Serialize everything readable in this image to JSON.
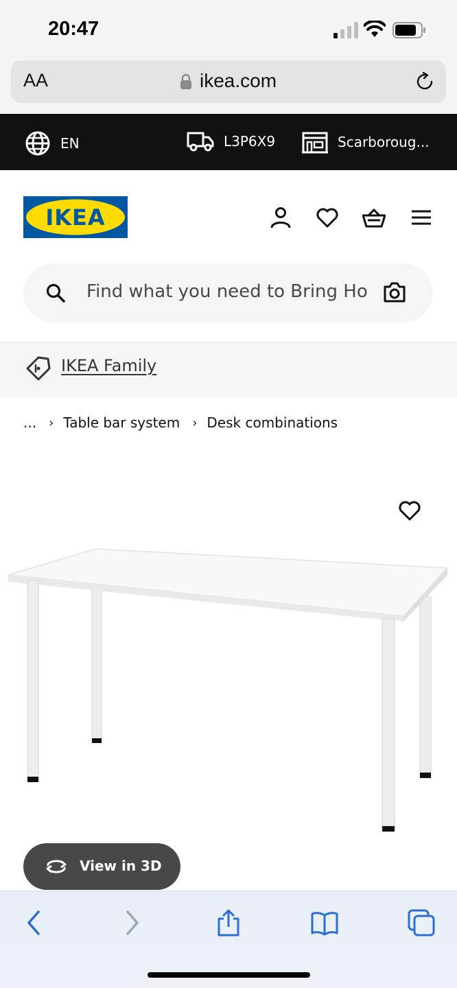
{
  "status_bar": {
    "time": "20:47",
    "icons": [
      "signal-icon",
      "wifi-icon",
      "battery-icon"
    ]
  },
  "browser": {
    "text_size_label": "AA",
    "url": "ikea.com",
    "icons": [
      "lock-icon",
      "reload-icon"
    ],
    "toolbar_icons": [
      "back-icon",
      "forward-icon",
      "share-icon",
      "bookmarks-icon",
      "tabs-icon"
    ]
  },
  "top_strip": {
    "language": "EN",
    "postal_code": "L3P6X9",
    "store": "Scarboroug..."
  },
  "header": {
    "logo_text": "IKEA",
    "brand_colors": {
      "blue": "#0058a3",
      "yellow": "#ffdb00"
    },
    "icons": [
      "account-icon",
      "heart-icon",
      "basket-icon",
      "menu-icon"
    ]
  },
  "search": {
    "placeholder": "Find what you need to Bring Home"
  },
  "family": {
    "link_text": "IKEA Family"
  },
  "breadcrumb": {
    "items": [
      "...",
      "Table bar system",
      "Desk combinations"
    ]
  },
  "product": {
    "view_3d_label": "View in 3D"
  }
}
